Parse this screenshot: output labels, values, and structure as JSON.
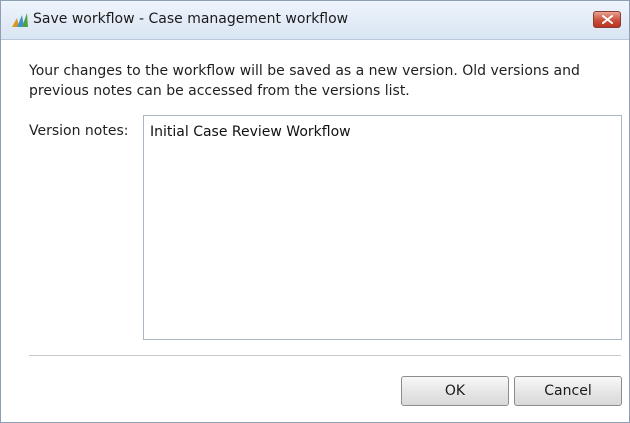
{
  "dialog": {
    "title": "Save workflow - Case management workflow",
    "app_icon": "crm-logo-icon",
    "close_icon": "close-icon"
  },
  "message": "Your changes to the workflow will be saved as a new version. Old versions and previous notes can be accessed from the versions list.",
  "version_notes": {
    "label": "Version notes:",
    "value": "Initial Case Review Workflow"
  },
  "buttons": {
    "ok_label": "OK",
    "cancel_label": "Cancel"
  },
  "colors": {
    "close_button": "#c9503c",
    "titlebar": "#dde8f4"
  }
}
